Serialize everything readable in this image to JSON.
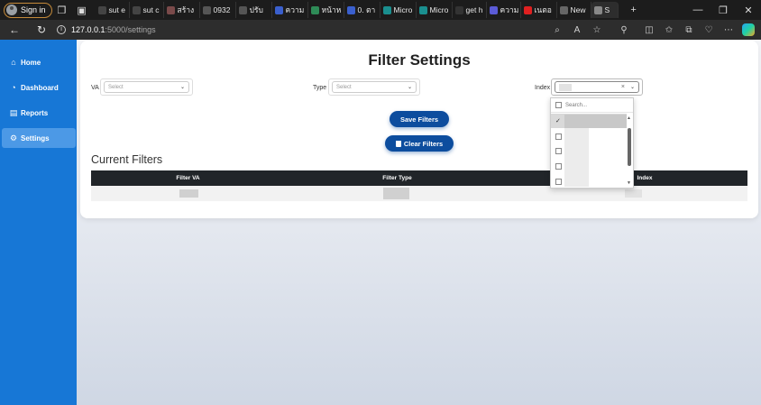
{
  "browser": {
    "signin_label": "Sign in",
    "tabs": [
      {
        "label": "sut e",
        "color": "#444444"
      },
      {
        "label": "sut c",
        "color": "#444444"
      },
      {
        "label": "สร้าง",
        "color": "#7a4a4a"
      },
      {
        "label": "0932",
        "color": "#555555"
      },
      {
        "label": "ปรับ",
        "color": "#555555"
      },
      {
        "label": "ความ",
        "color": "#3a5fcd"
      },
      {
        "label": "หน้าห",
        "color": "#2e8b57"
      },
      {
        "label": "0. ตา",
        "color": "#3a5fcd"
      },
      {
        "label": "Micro",
        "color": "#1a8f8f"
      },
      {
        "label": "Micro",
        "color": "#1a8f8f"
      },
      {
        "label": "get h",
        "color": "#333333"
      },
      {
        "label": "ความ",
        "color": "#5b5bd6"
      },
      {
        "label": "เนตอ",
        "color": "#e02020"
      },
      {
        "label": "New",
        "color": "#666666"
      },
      {
        "label": "S",
        "color": "#888888"
      }
    ],
    "url_host": "127.0.0.1",
    "url_path": ":5000/settings",
    "new_tab_symbol": "+"
  },
  "sidebar": {
    "items": [
      {
        "label": "Home",
        "icon": "home-icon",
        "glyph": "⌂"
      },
      {
        "label": "Dashboard",
        "icon": "dashboard-icon",
        "glyph": "◔"
      },
      {
        "label": "Reports",
        "icon": "file-icon",
        "glyph": "▤"
      },
      {
        "label": "Settings",
        "icon": "gear-icon",
        "glyph": "⚙"
      }
    ],
    "active_index": 3
  },
  "page": {
    "title": "Filter Settings",
    "filters": {
      "va_label": "VA",
      "va_placeholder": "Select",
      "type_label": "Type",
      "type_placeholder": "Select",
      "index_label": "Index"
    },
    "save_button": "Save Filters",
    "clear_button": "Clear Filters",
    "current_filters_title": "Current Filters",
    "table_headers": [
      "Filter VA",
      "Filter Type",
      "Index"
    ]
  },
  "dropdown": {
    "search_placeholder": "Search..."
  },
  "colors": {
    "sidebar": "#1777d6",
    "button": "#0d4d9e",
    "table_header": "#212529"
  }
}
